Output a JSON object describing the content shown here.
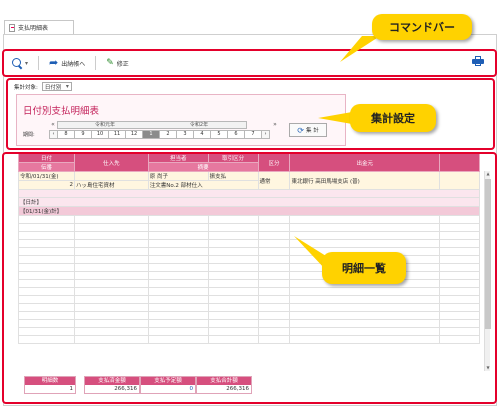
{
  "tab": {
    "label": "支払明細表"
  },
  "toolbar": {
    "export_label": "出納帳へ",
    "edit_label": "修正"
  },
  "callouts": {
    "command_bar": "コマンドバー",
    "aggregate_settings": "集計設定",
    "detail_list": "明細一覧"
  },
  "settings": {
    "aggregate_label": "集計対象:",
    "aggregate_value": "日付別",
    "report_title": "日付別支払明細表",
    "period_label": "期間:",
    "year_prev": "令和元年",
    "year_next": "令和2年",
    "months": [
      "8",
      "9",
      "10",
      "11",
      "12",
      "1",
      "2",
      "3",
      "4",
      "5",
      "6",
      "7"
    ],
    "selected_month": "1",
    "aggregate_button": "集 計"
  },
  "grid": {
    "headers_top": [
      "日付",
      "仕入先",
      "担当者",
      "取引区分",
      "区分",
      "出金元"
    ],
    "headers_bottom": [
      "伝番",
      "摘要"
    ],
    "rows": [
      {
        "date": "令和/01/31(金)",
        "vendor": "",
        "staff": "原 尚子",
        "trade": "振支払",
        "kind": "通常",
        "source": "東北銀行 高田馬場支店 (普)"
      },
      {
        "date": "2",
        "vendor": "ハッ島住宅資材",
        "staff": "注文書No.2 部材仕入",
        "trade": "",
        "kind": "",
        "source": ""
      }
    ],
    "subtotal_daily": "【日計】",
    "subtotal_cumulative": "【01/31(金)計】"
  },
  "footer": {
    "detail_count_label": "明細数",
    "detail_count": "1",
    "payment_label": "支払済金額",
    "payment_value": "266,316",
    "scheduled_label": "支払予定額",
    "scheduled_value": "0",
    "total_label": "支払合計額",
    "total_value": "266,316"
  },
  "colors": {
    "accent": "#d64f7e",
    "frame": "#e4002b",
    "callout": "#ffd200",
    "title": "#c4245c"
  }
}
